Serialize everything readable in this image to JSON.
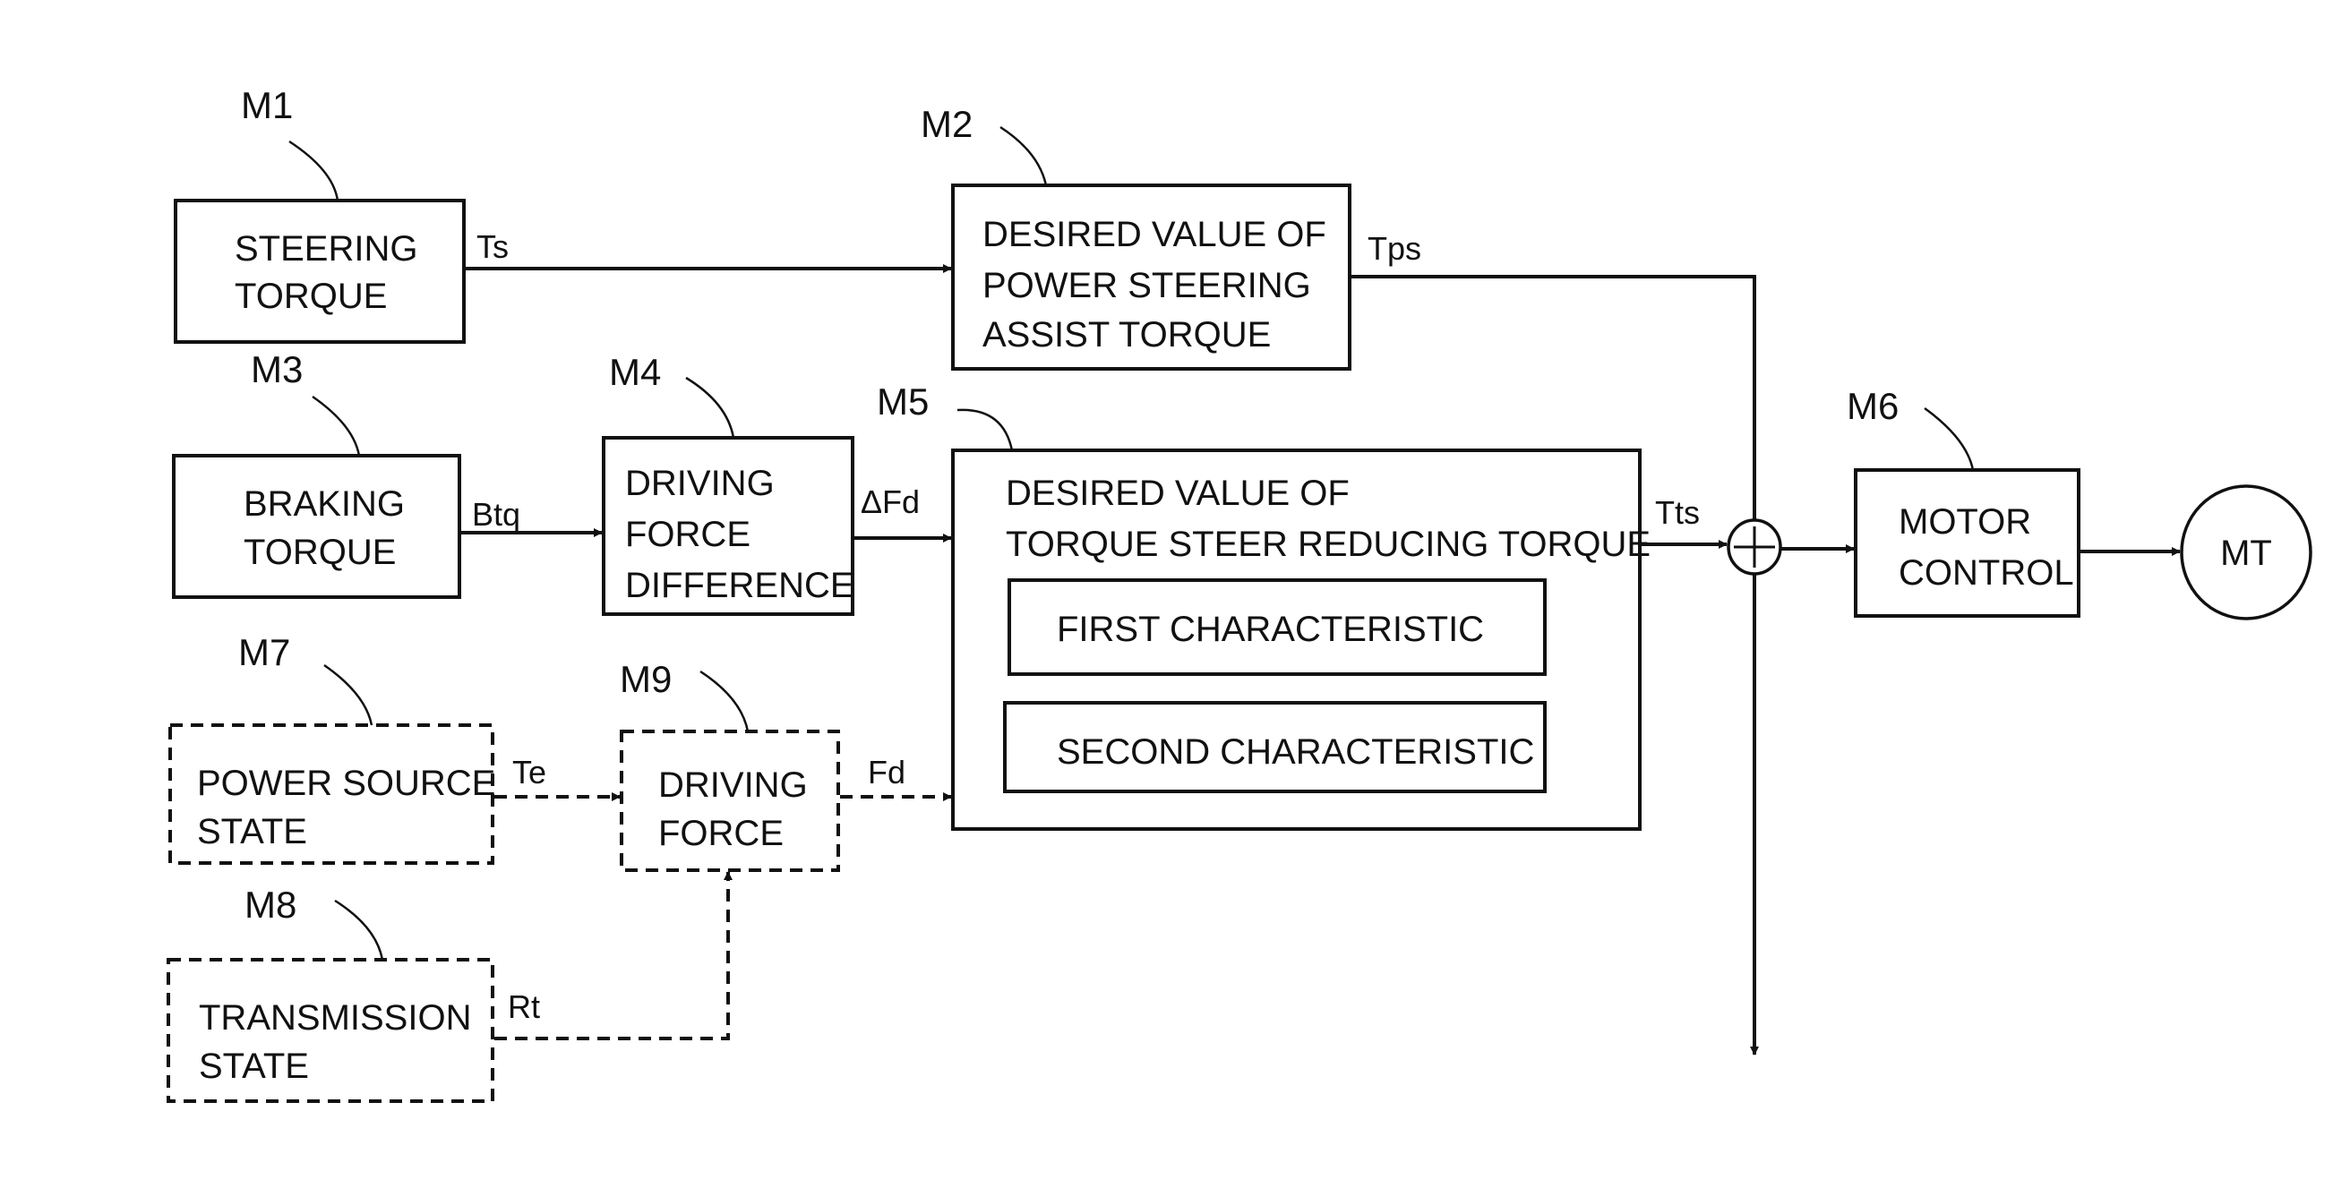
{
  "diagram": {
    "type": "block-diagram",
    "blocks": {
      "m1": {
        "ref": "M1",
        "lines": [
          "STEERING",
          "TORQUE"
        ],
        "style": "solid"
      },
      "m2": {
        "ref": "M2",
        "lines": [
          "DESIRED VALUE OF",
          "POWER STEERING",
          "ASSIST TORQUE"
        ],
        "style": "solid"
      },
      "m3": {
        "ref": "M3",
        "lines": [
          "BRAKING",
          "TORQUE"
        ],
        "style": "solid"
      },
      "m4": {
        "ref": "M4",
        "lines": [
          "DRIVING",
          "FORCE",
          "DIFFERENCE"
        ],
        "style": "solid"
      },
      "m5": {
        "ref": "M5",
        "lines": [
          "DESIRED VALUE OF",
          "TORQUE STEER REDUCING TORQUE"
        ],
        "style": "solid",
        "sub_blocks": [
          "FIRST CHARACTERISTIC",
          "SECOND CHARACTERISTIC"
        ]
      },
      "m6": {
        "ref": "M6",
        "lines": [
          "MOTOR",
          "CONTROL"
        ],
        "style": "solid"
      },
      "m7": {
        "ref": "M7",
        "lines": [
          "POWER SOURCE",
          "STATE"
        ],
        "style": "dashed"
      },
      "m8": {
        "ref": "M8",
        "lines": [
          "TRANSMISSION",
          "STATE"
        ],
        "style": "dashed"
      },
      "m9": {
        "ref": "M9",
        "lines": [
          "DRIVING",
          "FORCE"
        ],
        "style": "dashed"
      },
      "motor": {
        "label": "MT"
      },
      "summing_junction": {
        "symbol": "+"
      }
    },
    "signals": {
      "ts": "Ts",
      "tps": "Tps",
      "btq": "Btq",
      "dfd": "ΔFd",
      "tts": "Tts",
      "te": "Te",
      "fd": "Fd",
      "rt": "Rt"
    },
    "connections": [
      {
        "from": "M1",
        "to": "M2",
        "signal": "Ts",
        "style": "solid"
      },
      {
        "from": "M2",
        "to": "sum",
        "signal": "Tps",
        "style": "solid"
      },
      {
        "from": "M3",
        "to": "M4",
        "signal": "Btq",
        "style": "solid"
      },
      {
        "from": "M4",
        "to": "M5",
        "signal": "ΔFd",
        "style": "solid"
      },
      {
        "from": "M5",
        "to": "sum",
        "signal": "Tts",
        "style": "solid"
      },
      {
        "from": "sum",
        "to": "M6",
        "signal": "",
        "style": "solid"
      },
      {
        "from": "M6",
        "to": "MT",
        "signal": "",
        "style": "solid"
      },
      {
        "from": "M7",
        "to": "M9",
        "signal": "Te",
        "style": "dashed"
      },
      {
        "from": "M8",
        "to": "M9",
        "signal": "Rt",
        "style": "dashed"
      },
      {
        "from": "M9",
        "to": "M5",
        "signal": "Fd",
        "style": "dashed"
      }
    ]
  }
}
